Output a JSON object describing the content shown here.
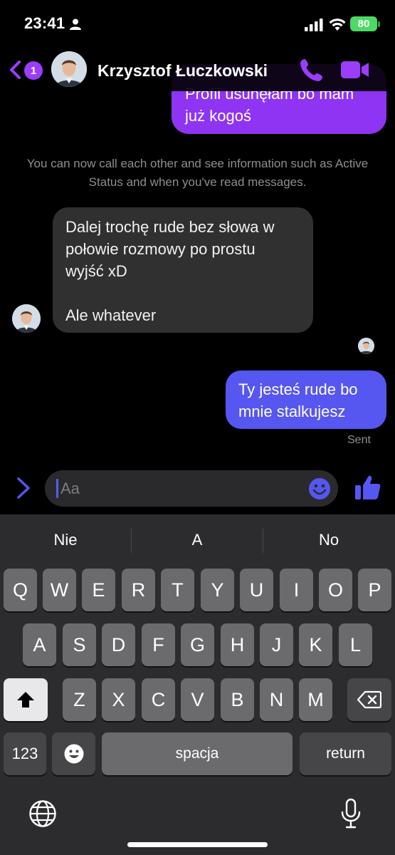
{
  "status_bar": {
    "time": "23:41",
    "battery": "80"
  },
  "header": {
    "unread_count": "1",
    "contact_name": "Krzysztof Łuczkowski",
    "accent_color": "#9b3dfa"
  },
  "messages": [
    {
      "direction": "out",
      "lines": [
        "Profil usunęłam bo mam",
        "już kogoś"
      ]
    },
    {
      "direction": "system",
      "text": "You can now call each other and see information such as Active Status and when you've read messages."
    },
    {
      "direction": "in",
      "lines": [
        "Dalej trochę rude bez słowa w",
        "połowie rozmowy po prostu",
        "wyjść xD",
        "",
        "Ale whatever"
      ]
    },
    {
      "direction": "out",
      "lines": [
        "Ty jesteś rude bo",
        "mnie stalkujesz"
      ],
      "status": "Sent"
    }
  ],
  "composer": {
    "placeholder": "Aa"
  },
  "keyboard": {
    "suggestions": [
      "Nie",
      "A",
      "No"
    ],
    "row1": [
      "Q",
      "W",
      "E",
      "R",
      "T",
      "Y",
      "U",
      "I",
      "O",
      "P"
    ],
    "row2": [
      "A",
      "S",
      "D",
      "F",
      "G",
      "H",
      "J",
      "K",
      "L"
    ],
    "row3": [
      "Z",
      "X",
      "C",
      "V",
      "B",
      "N",
      "M"
    ],
    "numbers_key": "123",
    "space_key": "spacja",
    "return_key": "return"
  },
  "icons": {
    "shift": "shift-icon",
    "backspace": "backspace-icon",
    "emoji": "emoji-icon",
    "globe": "globe-icon",
    "mic": "microphone-icon"
  }
}
